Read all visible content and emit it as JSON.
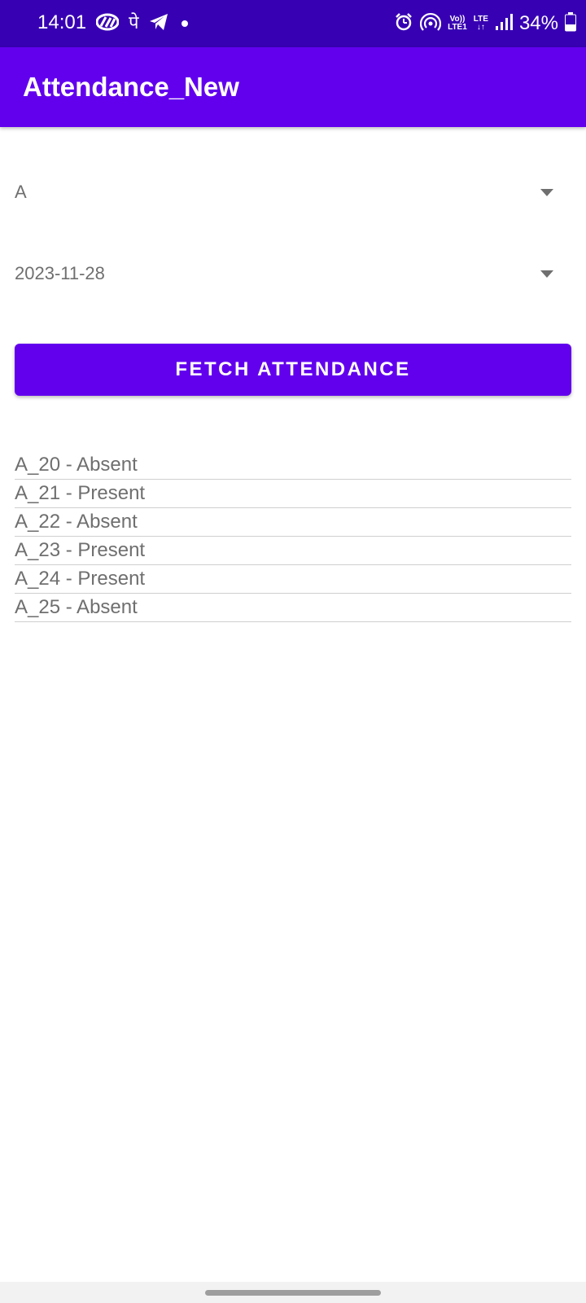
{
  "status_bar": {
    "time": "14:01",
    "left_icons": [
      "phonepe-wave-icon",
      "phonepe-icon",
      "telegram-icon",
      "notification-dot-icon"
    ],
    "pe_glyph": "पे",
    "right_icons": [
      "alarm-icon",
      "hotspot-icon",
      "volte-icon",
      "lte-icon",
      "signal-icon",
      "battery-icon"
    ],
    "volte_top": "Vo))",
    "volte_bottom": "LTE1",
    "lte_top": "LTE",
    "lte_bottom": "↓↑",
    "battery_percent": "34%",
    "background_color": "#3700b3"
  },
  "app_bar": {
    "title": "Attendance_New",
    "background_color": "#6200ee"
  },
  "class_spinner": {
    "selected": "A"
  },
  "date_spinner": {
    "selected": "2023-11-28"
  },
  "fetch_button": {
    "label": "FETCH ATTENDANCE",
    "background_color": "#6200ee"
  },
  "attendance": {
    "items": [
      "A_20 - Absent",
      "A_21 - Present",
      "A_22 - Absent",
      "A_23 - Present",
      "A_24 - Present",
      "A_25 - Absent"
    ]
  }
}
